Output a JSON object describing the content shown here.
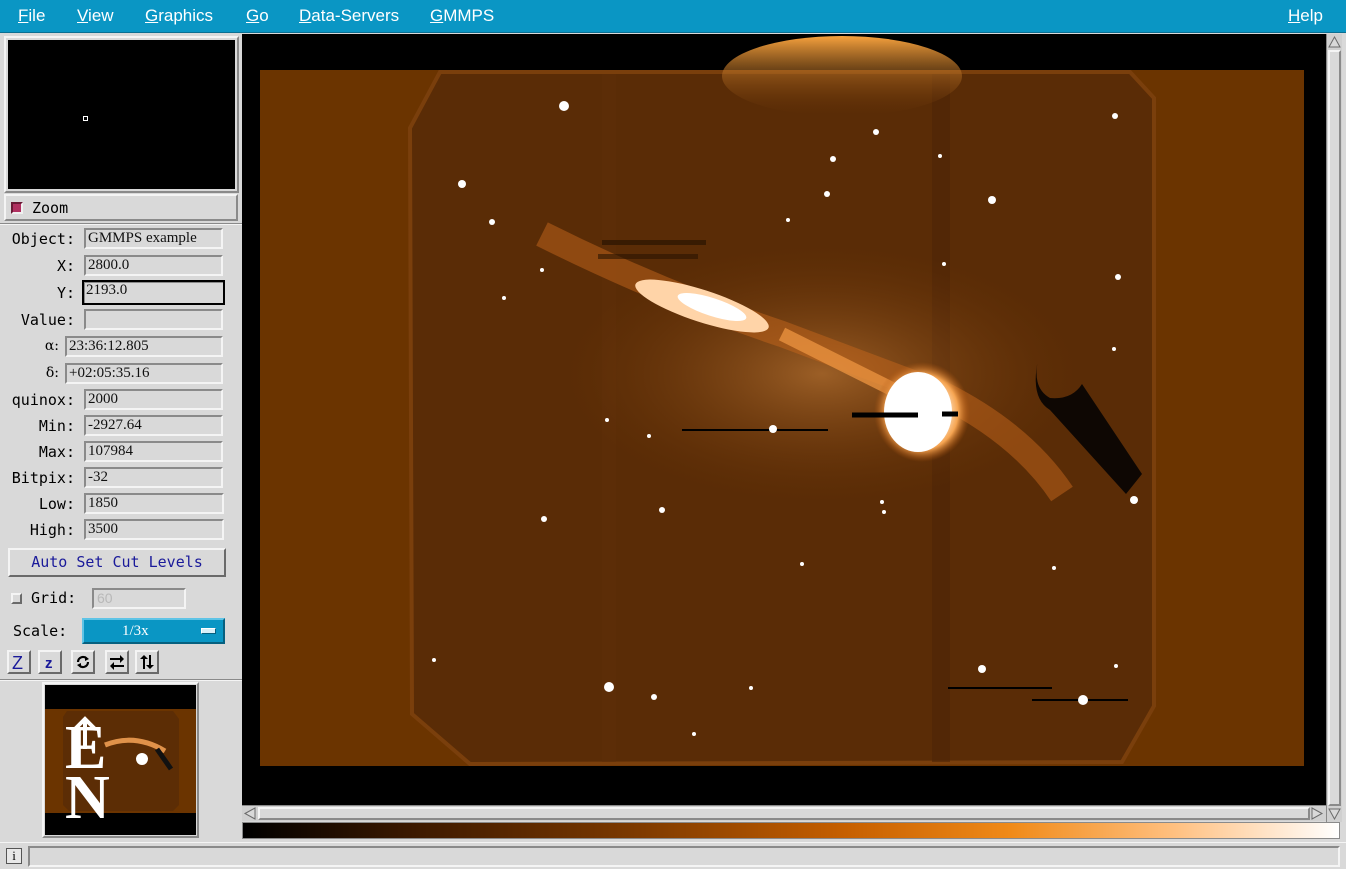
{
  "menubar": {
    "items": [
      {
        "accel": "F",
        "rest": "ile"
      },
      {
        "accel": "V",
        "rest": "iew"
      },
      {
        "accel": "G",
        "rest": "raphics"
      },
      {
        "accel": "G",
        "rest": "o"
      },
      {
        "accel": "D",
        "rest": "ata-Servers"
      },
      {
        "accel": "G",
        "rest": "MMPS"
      }
    ],
    "help": {
      "accel": "H",
      "rest": "elp"
    }
  },
  "zoom": {
    "label": "Zoom",
    "checked": true
  },
  "info": {
    "object": {
      "label": "Object:",
      "value": "GMMPS example"
    },
    "x": {
      "label": "X:",
      "value": "2800.0"
    },
    "y": {
      "label": "Y:",
      "value": "2193.0"
    },
    "value": {
      "label": "Value:",
      "value": ""
    },
    "alpha": {
      "label": "α:",
      "value": "23:36:12.805"
    },
    "delta": {
      "label": "δ:",
      "value": "+02:05:35.16"
    },
    "equinox": {
      "label": "quinox:",
      "value": "2000"
    },
    "min": {
      "label": "Min:",
      "value": "-2927.64"
    },
    "max": {
      "label": "Max:",
      "value": "107984"
    },
    "bitpix": {
      "label": "Bitpix:",
      "value": "-32"
    },
    "low": {
      "label": "Low:",
      "value": "1850"
    },
    "high": {
      "label": "High:",
      "value": "3500"
    }
  },
  "cut_button": "Auto Set Cut Levels",
  "grid": {
    "label": "Grid:",
    "value": "60",
    "checked": false
  },
  "scale": {
    "label": "Scale:",
    "value": "1/3x"
  },
  "toolbar": {
    "zoom_in": "Z",
    "zoom_out": "z"
  },
  "compass": {
    "east": "E",
    "north": "N"
  },
  "status": {
    "icon": "i",
    "text": ""
  },
  "colors": {
    "menubar": "#0a96c4",
    "image_background": "#6b3400",
    "accent_check": "#b03060"
  },
  "icons": [
    "rotate-icon",
    "flip-x-icon",
    "flip-y-icon",
    "info-icon",
    "scroll-arrow-icon"
  ]
}
